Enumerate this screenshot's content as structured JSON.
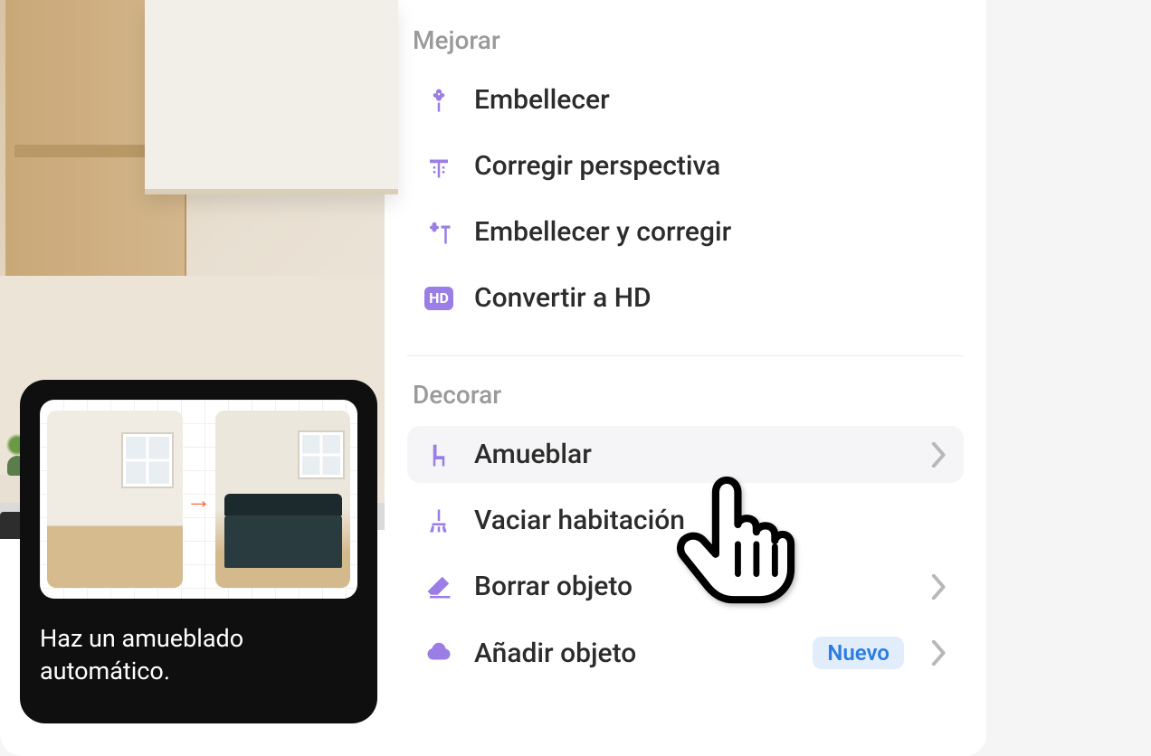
{
  "sections": {
    "enhance": {
      "header": "Mejorar",
      "items": [
        {
          "label": "Embellecer"
        },
        {
          "label": "Corregir perspectiva"
        },
        {
          "label": "Embellecer y corregir"
        },
        {
          "label": "Convertir a HD"
        }
      ]
    },
    "decorate": {
      "header": "Decorar",
      "items": [
        {
          "label": "Amueblar"
        },
        {
          "label": "Vaciar habitación"
        },
        {
          "label": "Borrar objeto"
        },
        {
          "label": "Añadir objeto",
          "badge": "Nuevo"
        }
      ]
    }
  },
  "tooltip": {
    "text": "Haz un amueblado automático."
  },
  "hd_icon_label": "HD"
}
